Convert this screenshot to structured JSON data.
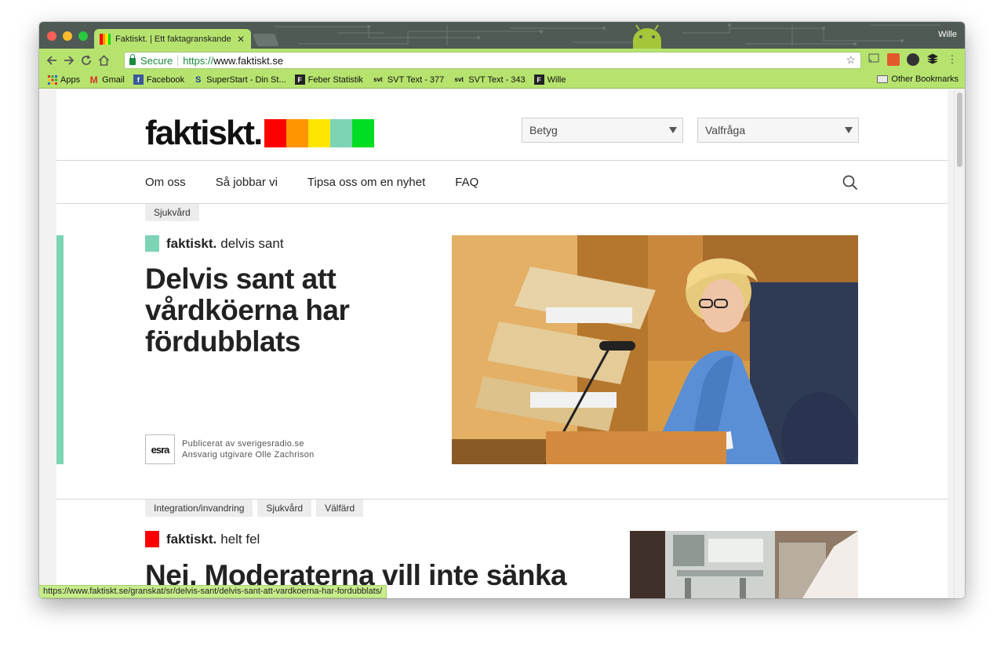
{
  "window": {
    "tab_title": "Faktiskt. | Ett faktagranskande",
    "tab_close": "✕",
    "user_name": "Wille"
  },
  "toolbar": {
    "secure_label": "Secure",
    "url_scheme": "https://",
    "url_host": "www.faktiskt.se"
  },
  "bookmarks": {
    "items": [
      {
        "label": "Apps",
        "icon": "apps-grid-icon"
      },
      {
        "label": "Gmail",
        "icon": "gmail-icon"
      },
      {
        "label": "Facebook",
        "icon": "facebook-icon"
      },
      {
        "label": "SuperStart - Din St...",
        "icon": "superstart-icon"
      },
      {
        "label": "Feber Statistik",
        "icon": "feber-icon"
      },
      {
        "label": "SVT Text - 377",
        "icon": "svt-icon"
      },
      {
        "label": "SVT Text - 343",
        "icon": "svt-icon"
      },
      {
        "label": "Wille",
        "icon": "feber-icon"
      }
    ],
    "other": "Other Bookmarks"
  },
  "site": {
    "logo_text": "faktiskt.",
    "logo_colors": [
      "#ff0000",
      "#ff9500",
      "#ffe600",
      "#7dd4b4",
      "#00dd22"
    ],
    "filters": {
      "rating": "Betyg",
      "election_question": "Valfråga"
    },
    "nav": [
      "Om oss",
      "Så jobbar vi",
      "Tipsa oss om en nyhet",
      "FAQ"
    ]
  },
  "articles": [
    {
      "tags": [
        "Sjukvård"
      ],
      "brand": "faktiskt.",
      "verdict": "delvis sant",
      "verdict_color": "#7dd4b4",
      "headline_lines": [
        "Delvis sant att",
        "vårdköerna har",
        "fördubblats"
      ],
      "publisher_logo": "esra",
      "published_by": "Publicerat av sverigesradio.se",
      "editor": "Ansvarig utgivare Olle Zachrison"
    },
    {
      "tags": [
        "Integration/invandring",
        "Sjukvård",
        "Välfärd"
      ],
      "brand": "faktiskt.",
      "verdict": "helt fel",
      "verdict_color": "#ff0000",
      "headline": "Nej, Moderaterna vill inte sänka"
    }
  ],
  "status_url": "https://www.faktiskt.se/granskat/sr/delvis-sant/delvis-sant-att-vardkoerna-har-fordubblats/"
}
